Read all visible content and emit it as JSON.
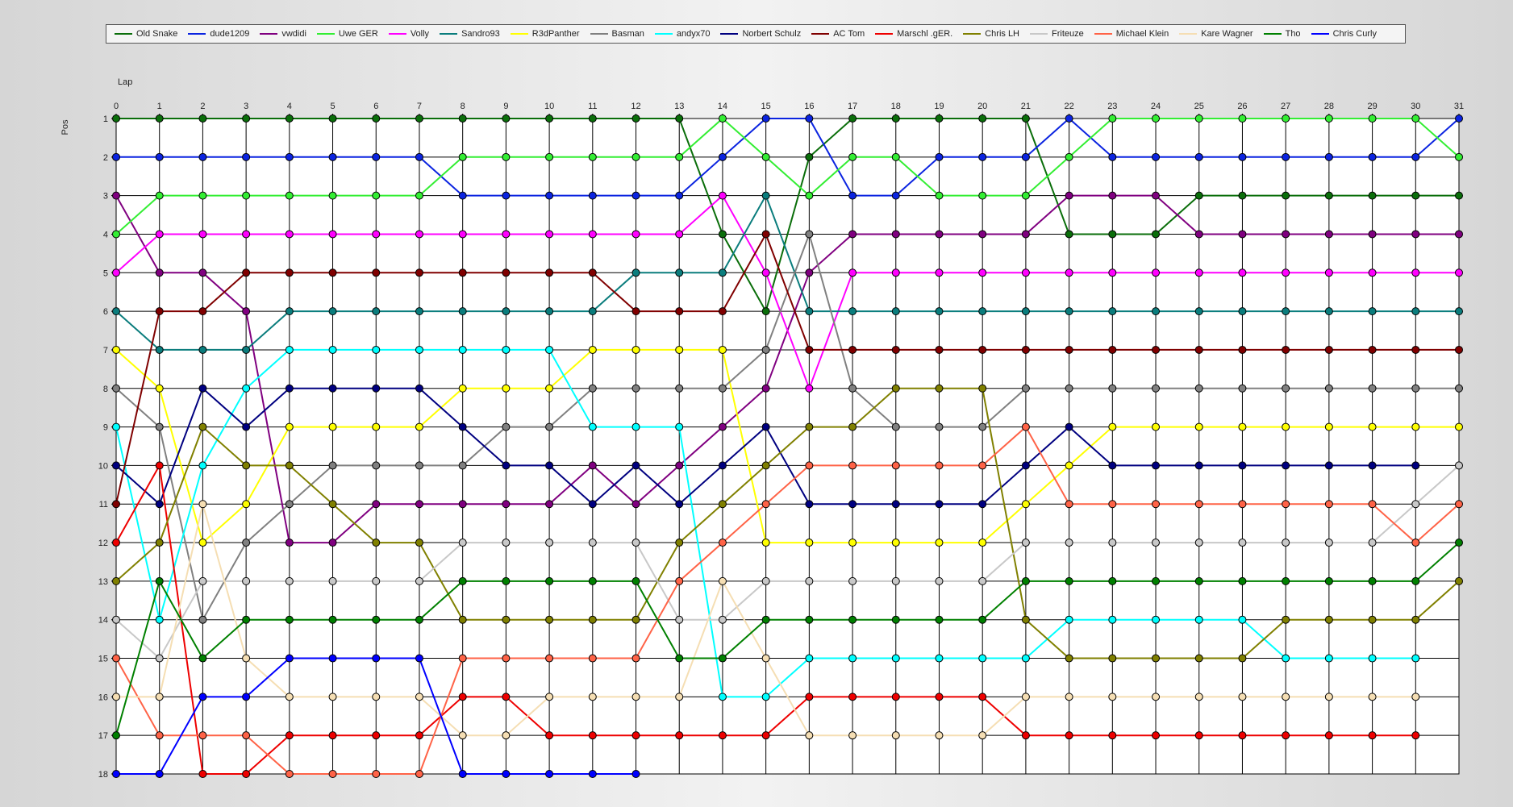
{
  "chart_data": {
    "type": "line",
    "xlabel": "Lap",
    "ylabel": "Pos",
    "xlim": [
      0,
      31
    ],
    "ylim": [
      1,
      18
    ],
    "x": [
      0,
      1,
      2,
      3,
      4,
      5,
      6,
      7,
      8,
      9,
      10,
      11,
      12,
      13,
      14,
      15,
      16,
      17,
      18,
      19,
      20,
      21,
      22,
      23,
      24,
      25,
      26,
      27,
      28,
      29,
      30,
      31
    ],
    "y_ticks": [
      1,
      2,
      3,
      4,
      5,
      6,
      7,
      8,
      9,
      10,
      11,
      12,
      13,
      14,
      15,
      16,
      17,
      18
    ],
    "y_inverted": true,
    "grid": true,
    "markers": "circle",
    "legend_position": "top",
    "series": [
      {
        "name": "Old Snake",
        "color": "#0a6e0a",
        "values": [
          1,
          1,
          1,
          1,
          1,
          1,
          1,
          1,
          1,
          1,
          1,
          1,
          1,
          1,
          4,
          6,
          2,
          1,
          1,
          1,
          1,
          1,
          4,
          4,
          4,
          3,
          3,
          3,
          3,
          3,
          3,
          3
        ]
      },
      {
        "name": "dude1209",
        "color": "#0b24e0",
        "values": [
          2,
          2,
          2,
          2,
          2,
          2,
          2,
          2,
          3,
          3,
          3,
          3,
          3,
          3,
          2,
          1,
          1,
          3,
          3,
          2,
          2,
          2,
          1,
          2,
          2,
          2,
          2,
          2,
          2,
          2,
          2,
          1
        ]
      },
      {
        "name": "vwdidi",
        "color": "#800080",
        "values": [
          3,
          5,
          5,
          6,
          12,
          12,
          11,
          11,
          11,
          11,
          11,
          10,
          11,
          10,
          9,
          8,
          5,
          4,
          4,
          4,
          4,
          4,
          3,
          3,
          3,
          4,
          4,
          4,
          4,
          4,
          4,
          4
        ]
      },
      {
        "name": "Uwe GER",
        "color": "#33ee33",
        "values": [
          4,
          3,
          3,
          3,
          3,
          3,
          3,
          3,
          2,
          2,
          2,
          2,
          2,
          2,
          1,
          2,
          3,
          2,
          2,
          3,
          3,
          3,
          2,
          1,
          1,
          1,
          1,
          1,
          1,
          1,
          1,
          2
        ]
      },
      {
        "name": "Volly",
        "color": "#ff00ff",
        "values": [
          5,
          4,
          4,
          4,
          4,
          4,
          4,
          4,
          4,
          4,
          4,
          4,
          4,
          4,
          3,
          5,
          8,
          5,
          5,
          5,
          5,
          5,
          5,
          5,
          5,
          5,
          5,
          5,
          5,
          5,
          5,
          5
        ]
      },
      {
        "name": "Sandro93",
        "color": "#0b7d7d",
        "values": [
          6,
          7,
          7,
          7,
          6,
          6,
          6,
          6,
          6,
          6,
          6,
          6,
          5,
          5,
          5,
          3,
          6,
          6,
          6,
          6,
          6,
          6,
          6,
          6,
          6,
          6,
          6,
          6,
          6,
          6,
          6,
          6
        ]
      },
      {
        "name": "R3dPanther",
        "color": "#ffff00",
        "values": [
          7,
          8,
          12,
          11,
          9,
          9,
          9,
          9,
          8,
          8,
          8,
          7,
          7,
          7,
          7,
          12,
          12,
          12,
          12,
          12,
          12,
          11,
          10,
          9,
          9,
          9,
          9,
          9,
          9,
          9,
          9,
          9
        ]
      },
      {
        "name": "Basman",
        "color": "#808080",
        "values": [
          8,
          9,
          14,
          12,
          11,
          10,
          10,
          10,
          10,
          9,
          9,
          8,
          8,
          8,
          8,
          7,
          4,
          8,
          9,
          9,
          9,
          8,
          8,
          8,
          8,
          8,
          8,
          8,
          8,
          8,
          8,
          8
        ]
      },
      {
        "name": "andyx70",
        "color": "#00ffff",
        "values": [
          9,
          14,
          10,
          8,
          7,
          7,
          7,
          7,
          7,
          7,
          7,
          9,
          9,
          9,
          16,
          16,
          15,
          15,
          15,
          15,
          15,
          15,
          14,
          14,
          14,
          14,
          14,
          15,
          15,
          15,
          15,
          null
        ]
      },
      {
        "name": "Norbert Schulz",
        "color": "#000080",
        "values": [
          10,
          11,
          8,
          9,
          8,
          8,
          8,
          8,
          9,
          10,
          10,
          11,
          10,
          11,
          10,
          9,
          11,
          11,
          11,
          11,
          11,
          10,
          9,
          10,
          10,
          10,
          10,
          10,
          10,
          10,
          10,
          null
        ]
      },
      {
        "name": "AC Tom",
        "color": "#800000",
        "values": [
          11,
          6,
          6,
          5,
          5,
          5,
          5,
          5,
          5,
          5,
          5,
          5,
          6,
          6,
          6,
          4,
          7,
          7,
          7,
          7,
          7,
          7,
          7,
          7,
          7,
          7,
          7,
          7,
          7,
          7,
          7,
          7
        ]
      },
      {
        "name": "Marschl .gER.",
        "color": "#ee0000",
        "values": [
          12,
          10,
          18,
          18,
          17,
          17,
          17,
          17,
          16,
          16,
          17,
          17,
          17,
          17,
          17,
          17,
          16,
          16,
          16,
          16,
          16,
          17,
          17,
          17,
          17,
          17,
          17,
          17,
          17,
          17,
          17,
          null
        ]
      },
      {
        "name": "Chris LH",
        "color": "#808000",
        "values": [
          13,
          12,
          9,
          10,
          10,
          11,
          12,
          12,
          14,
          14,
          14,
          14,
          14,
          12,
          11,
          10,
          9,
          9,
          8,
          8,
          8,
          14,
          15,
          15,
          15,
          15,
          15,
          14,
          14,
          14,
          14,
          13
        ]
      },
      {
        "name": "Friteuze",
        "color": "#c8c8c8",
        "values": [
          14,
          15,
          13,
          13,
          13,
          13,
          13,
          13,
          12,
          12,
          12,
          12,
          12,
          14,
          14,
          13,
          13,
          13,
          13,
          13,
          13,
          12,
          12,
          12,
          12,
          12,
          12,
          12,
          12,
          12,
          11,
          10
        ]
      },
      {
        "name": "Michael Klein",
        "color": "#ff6347",
        "values": [
          15,
          17,
          17,
          17,
          18,
          18,
          18,
          18,
          15,
          15,
          15,
          15,
          15,
          13,
          12,
          11,
          10,
          10,
          10,
          10,
          10,
          9,
          11,
          11,
          11,
          11,
          11,
          11,
          11,
          11,
          12,
          11
        ]
      },
      {
        "name": "Kare Wagner",
        "color": "#f5deb3",
        "values": [
          16,
          16,
          11,
          15,
          16,
          16,
          16,
          16,
          17,
          17,
          16,
          16,
          16,
          16,
          13,
          15,
          17,
          17,
          17,
          17,
          17,
          16,
          16,
          16,
          16,
          16,
          16,
          16,
          16,
          16,
          16,
          null
        ]
      },
      {
        "name": "Tho",
        "color": "#008000",
        "values": [
          17,
          13,
          15,
          14,
          14,
          14,
          14,
          14,
          13,
          13,
          13,
          13,
          13,
          15,
          15,
          14,
          14,
          14,
          14,
          14,
          14,
          13,
          13,
          13,
          13,
          13,
          13,
          13,
          13,
          13,
          13,
          12
        ]
      },
      {
        "name": "Chris Curly",
        "color": "#0000ff",
        "values": [
          18,
          18,
          16,
          16,
          15,
          15,
          15,
          15,
          18,
          18,
          18,
          18,
          18,
          null,
          null,
          null,
          null,
          null,
          null,
          null,
          null,
          null,
          null,
          null,
          null,
          null,
          null,
          null,
          null,
          null,
          null,
          null
        ]
      }
    ]
  }
}
